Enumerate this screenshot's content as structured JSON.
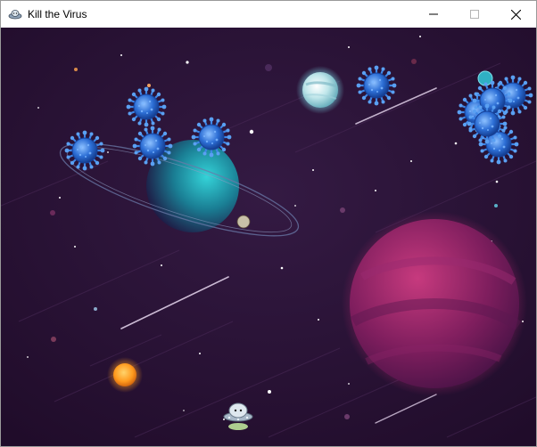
{
  "window": {
    "title": "Kill the Virus",
    "icons": {
      "app": "ufo-icon",
      "minimize": "minimize-icon",
      "maximize": "maximize-icon",
      "close": "close-icon"
    }
  },
  "game": {
    "player_sprite": "ufo-ship",
    "enemy_sprite": "virus-icon",
    "virus_count": 10,
    "background": "space-scene",
    "colors": {
      "space": "#2a1234",
      "virus": "#2d6fd6",
      "pink_planet": "#b0286e",
      "teal_planet": "#21a6b6",
      "orange_planet": "#ff9a1e",
      "ice_planet": "#bfe6ea"
    }
  }
}
